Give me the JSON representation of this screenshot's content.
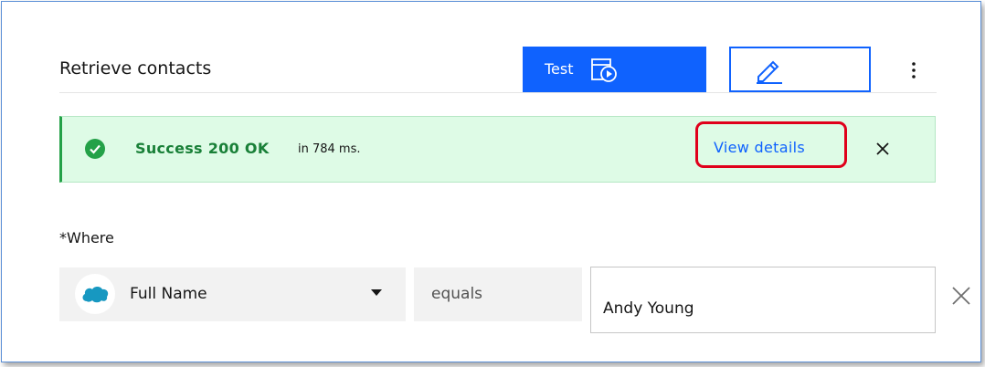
{
  "card": {
    "title": "Retrieve contacts",
    "test_button_label": "Test",
    "test_icon": "test-run-icon",
    "edit_icon": "pencil-icon",
    "overflow_icon": "overflow-menu-vertical-icon"
  },
  "notification": {
    "status": "Success 200 OK",
    "subtitle": "in 784 ms.",
    "action_label": "View details",
    "status_icon": "checkmark-filled-icon",
    "close_icon": "close-icon",
    "accent_color": "#24a148",
    "background_color": "#defbe6"
  },
  "condition": {
    "label": "*Where",
    "field": "Full Name",
    "field_source_icon": "salesforce-icon",
    "operator": "equals",
    "value": "Andy Young",
    "remove_icon": "close-icon"
  },
  "colors": {
    "primary": "#0f62fe",
    "highlight": "#e0001b"
  }
}
